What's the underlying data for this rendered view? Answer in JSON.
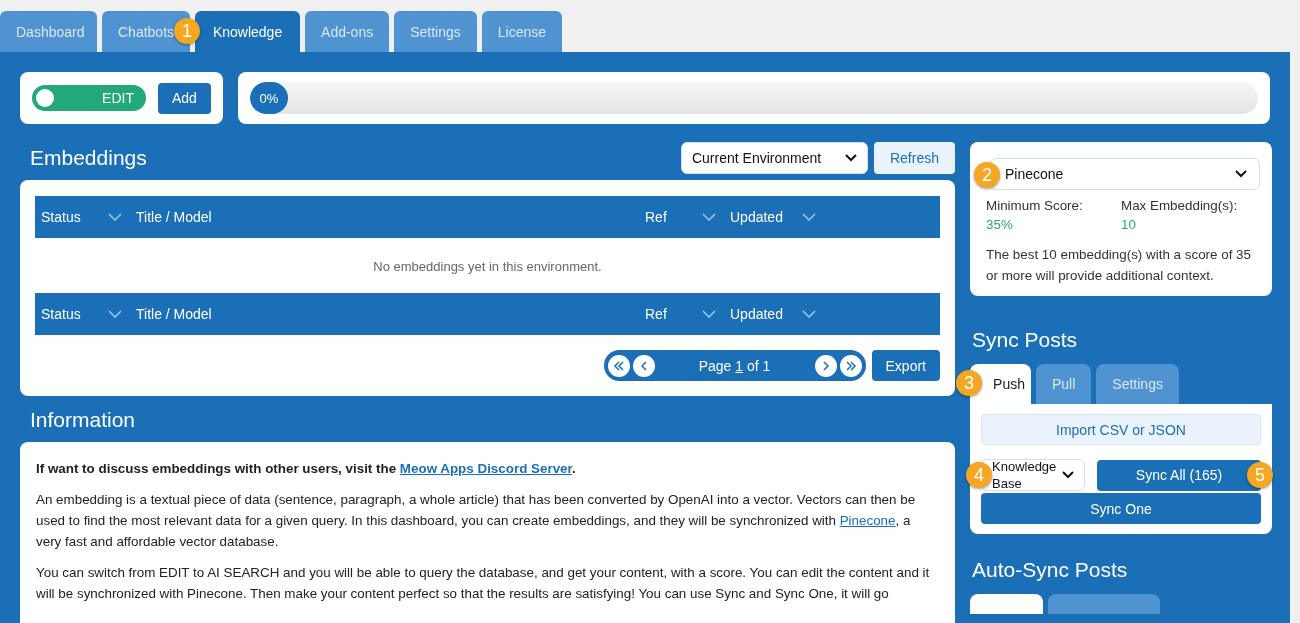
{
  "tabs": [
    {
      "label": "Dashboard",
      "selected": false
    },
    {
      "label": "Chatbots",
      "selected": false
    },
    {
      "label": "Knowledge",
      "selected": true
    },
    {
      "label": "Add-ons",
      "selected": false
    },
    {
      "label": "Settings",
      "selected": false
    },
    {
      "label": "License",
      "selected": false
    }
  ],
  "mode_toggle": {
    "label": "EDIT",
    "on": true
  },
  "add_button": "Add",
  "progress": {
    "label": "0%",
    "level": 0
  },
  "embeddings": {
    "title": "Embeddings",
    "environment": "Current Environment",
    "refresh": "Refresh",
    "header_rows": [
      [
        {
          "label": "Status",
          "sortable": true
        },
        {
          "label": "Title / Model",
          "sortable": false
        },
        {
          "label": "Ref",
          "sortable": true
        },
        {
          "label": "Updated",
          "sortable": true
        }
      ],
      [
        {
          "label": "Status",
          "sortable": true
        },
        {
          "label": "Title / Model",
          "sortable": false
        },
        {
          "label": "Ref",
          "sortable": true
        },
        {
          "label": "Updated",
          "sortable": true
        }
      ]
    ],
    "empty_message": "No embeddings yet in this environment.",
    "pagination": {
      "prefix": "Page",
      "current": "1",
      "suffix": "of 1"
    },
    "export": "Export"
  },
  "information": {
    "title": "Information",
    "paragraphs": [
      {
        "bold": true,
        "parts": [
          {
            "text": "If want to discuss embeddings with other users, visit the "
          },
          {
            "text": "Meow Apps Discord Server",
            "link": true
          },
          {
            "text": "."
          }
        ]
      },
      {
        "bold": false,
        "parts": [
          {
            "text": "An embedding is a textual piece of data (sentence, paragraph, a whole article) that has been converted by OpenAI into a vector. Vectors can then be used to find the most relevant data for a given query. In this dashboard, you can create embeddings, and they will be synchronized with "
          },
          {
            "text": "Pinecone",
            "link": true
          },
          {
            "text": ", a very fast and affordable vector database."
          }
        ]
      },
      {
        "bold": false,
        "parts": [
          {
            "text": "You can switch from EDIT to AI SEARCH and you will be able to query the database, and get your content, with a score. You can edit the content and it will be synchronized with Pinecone. Then make your content perfect so that the results are satisfying! You can use Sync and Sync One, it will go"
          }
        ]
      }
    ]
  },
  "index": {
    "service": "Pinecone",
    "min_score_label": "Minimum Score:",
    "min_score": "35%",
    "max_label": "Max Embedding(s):",
    "max": "10",
    "description": "The best 10 embedding(s) with a score of 35 or more will provide additional context."
  },
  "sync_posts": {
    "title": "Sync Posts",
    "tabs": [
      {
        "label": "Push",
        "selected": true
      },
      {
        "label": "Pull",
        "selected": false
      },
      {
        "label": "Settings",
        "selected": false
      }
    ],
    "import": "Import CSV or JSON",
    "post_type": "Knowledge Base",
    "sync_all": "Sync All (165)",
    "sync_one": "Sync One"
  },
  "auto_sync": {
    "title": "Auto-Sync Posts",
    "tabs": [
      {
        "selected": true
      },
      {
        "selected": false
      }
    ]
  },
  "callouts": [
    "1",
    "2",
    "3",
    "4",
    "5"
  ]
}
